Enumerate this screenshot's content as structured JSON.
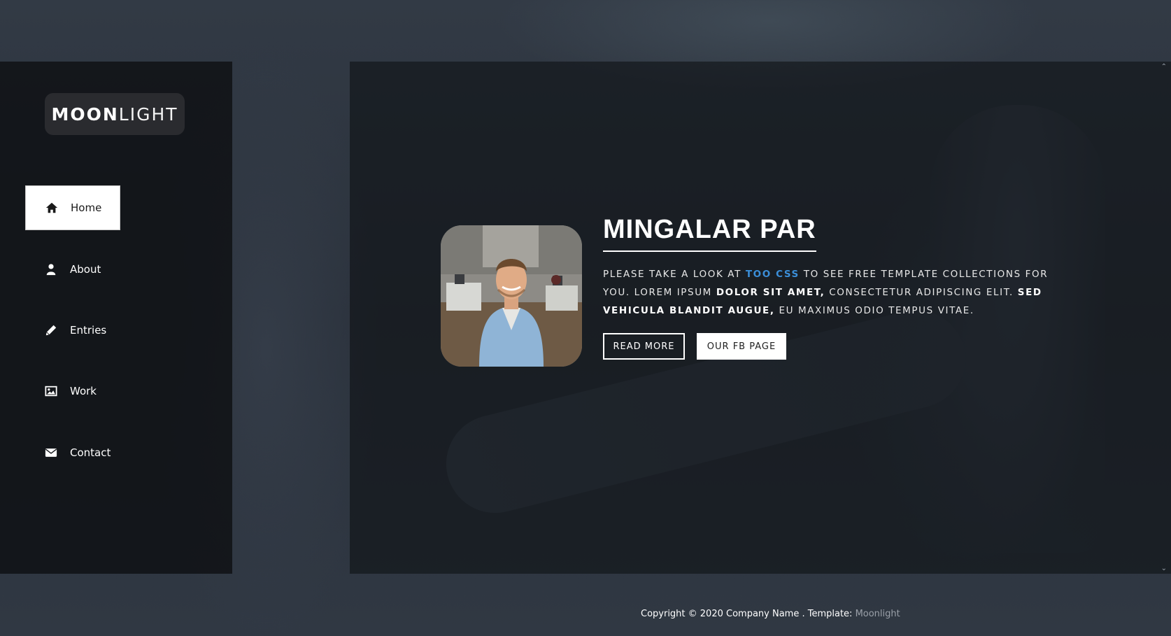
{
  "logo": {
    "bold": "MOON",
    "light": "LIGHT"
  },
  "nav": {
    "items": [
      {
        "label": "Home",
        "icon": "home-icon",
        "active": true
      },
      {
        "label": "About",
        "icon": "user-icon",
        "active": false
      },
      {
        "label": "Entries",
        "icon": "pencil-icon",
        "active": false
      },
      {
        "label": "Work",
        "icon": "image-icon",
        "active": false
      },
      {
        "label": "Contact",
        "icon": "envelope-icon",
        "active": false
      }
    ]
  },
  "main": {
    "headline": "MINGALAR PAR",
    "intro": {
      "p1": "PLEASE TAKE A LOOK AT ",
      "link": "TOO CSS",
      "p2": " TO SEE FREE TEMPLATE COLLECTIONS FOR YOU. LOREM IPSUM ",
      "b1": "DOLOR SIT AMET,",
      "p3": " CONSECTETUR ADIPISCING ELIT. ",
      "b2": "SED VEHICULA BLANDIT AUGUE,",
      "p4": " EU MAXIMUS ODIO TEMPUS VITAE."
    },
    "buttons": {
      "read_more": "READ MORE",
      "fb_page": "OUR FB PAGE"
    }
  },
  "footer": {
    "copyright": "Copyright © 2020 Company Name . Template: ",
    "template_name": "Moonlight"
  },
  "colors": {
    "accent_link": "#3b8fd9",
    "sidebar_bg": "#101216",
    "button_fill": "#ffffff"
  }
}
